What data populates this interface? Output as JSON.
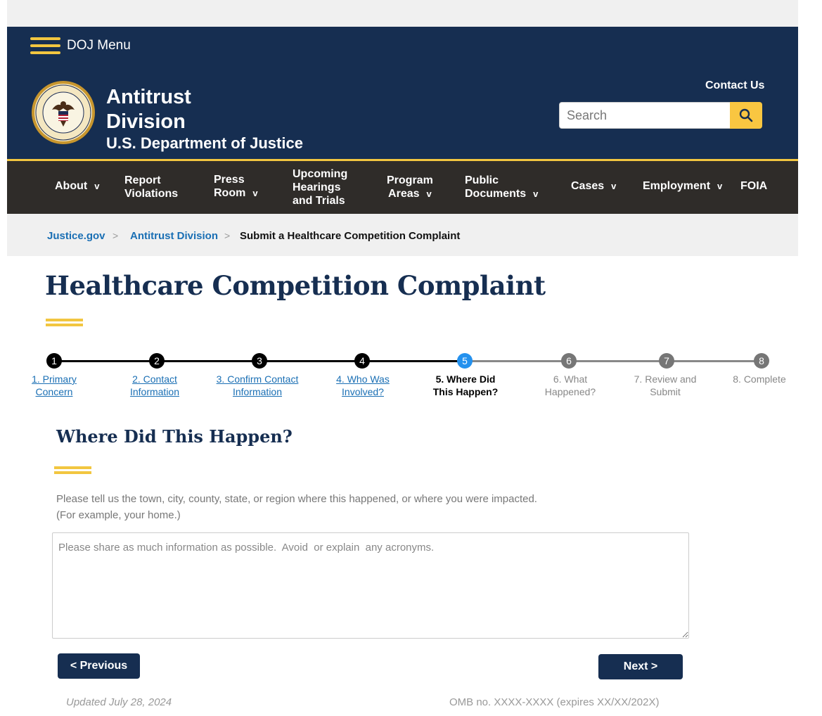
{
  "header": {
    "menu_label": "DOJ Menu",
    "title_line1": "Antitrust",
    "title_line2": "Division",
    "subtitle": "U.S. Department of Justice",
    "contact_label": "Contact Us",
    "search_placeholder": "Search",
    "search_value": ""
  },
  "nav": {
    "items": [
      {
        "line1": "About",
        "line2": "",
        "line3": "",
        "has_dropdown": true
      },
      {
        "line1": "Report",
        "line2": "Violations",
        "line3": "",
        "has_dropdown": false
      },
      {
        "line1": "Press",
        "line2": "Room",
        "line3": "",
        "has_dropdown": true
      },
      {
        "line1": "Upcoming",
        "line2": "Hearings",
        "line3": "and Trials",
        "has_dropdown": false
      },
      {
        "line1": "Program",
        "line2": "Areas",
        "line3": "",
        "has_dropdown": true
      },
      {
        "line1": "Public",
        "line2": "Documents",
        "line3": "",
        "has_dropdown": true
      },
      {
        "line1": "Cases",
        "line2": "",
        "line3": "",
        "has_dropdown": true
      },
      {
        "line1": "Employment",
        "line2": "",
        "line3": "",
        "has_dropdown": true
      },
      {
        "line1": "FOIA",
        "line2": "",
        "line3": "",
        "has_dropdown": false
      }
    ],
    "dropdown_glyph": "v"
  },
  "breadcrumb": {
    "items": [
      "Justice.gov",
      "Antitrust Division"
    ],
    "separator": ">",
    "current": "Submit a Healthcare Competition Complaint"
  },
  "page": {
    "title": "Healthcare Competition Complaint"
  },
  "stepper": {
    "current_step": 5,
    "steps": [
      {
        "number": "1",
        "line1": "1. Primary",
        "line2": "Concern",
        "status": "done"
      },
      {
        "number": "2",
        "line1": "2. Contact",
        "line2": "Information",
        "status": "done"
      },
      {
        "number": "3",
        "line1": "3. Confirm Contact",
        "line2": "Information",
        "status": "done"
      },
      {
        "number": "4",
        "line1": "4. Who Was",
        "line2": "Involved?",
        "status": "done"
      },
      {
        "number": "5",
        "line1": "5. Where Did",
        "line2": "This Happen?",
        "status": "current"
      },
      {
        "number": "6",
        "line1": "6. What",
        "line2": "Happened?",
        "status": "future"
      },
      {
        "number": "7",
        "line1": "7. Review and",
        "line2": "Submit",
        "status": "future"
      },
      {
        "number": "8",
        "line1": "8. Complete",
        "line2": "",
        "status": "future"
      }
    ]
  },
  "form": {
    "section_title": "Where Did This Happen?",
    "instructions_line1": "Please tell us the town, city, county, state, or region where this happened,  or where you were impacted.",
    "instructions_line2": "(For example,  your home.)",
    "textarea_placeholder": "Please share as much information as possible.  Avoid  or explain  any acronyms.",
    "textarea_value": "",
    "previous_label": "< Previous",
    "next_label": "Next >"
  },
  "footer": {
    "updated": "Updated July 28, 2024",
    "omb": "OMB  no.  XXXX-XXXX  (expires XX/XX/202X)"
  },
  "colors": {
    "navy": "#162e51",
    "gold": "#f2c640",
    "nav_bg": "#2f2c29",
    "link_blue": "#1a6fb4",
    "step_current": "#2491ee",
    "step_future": "#767676"
  }
}
